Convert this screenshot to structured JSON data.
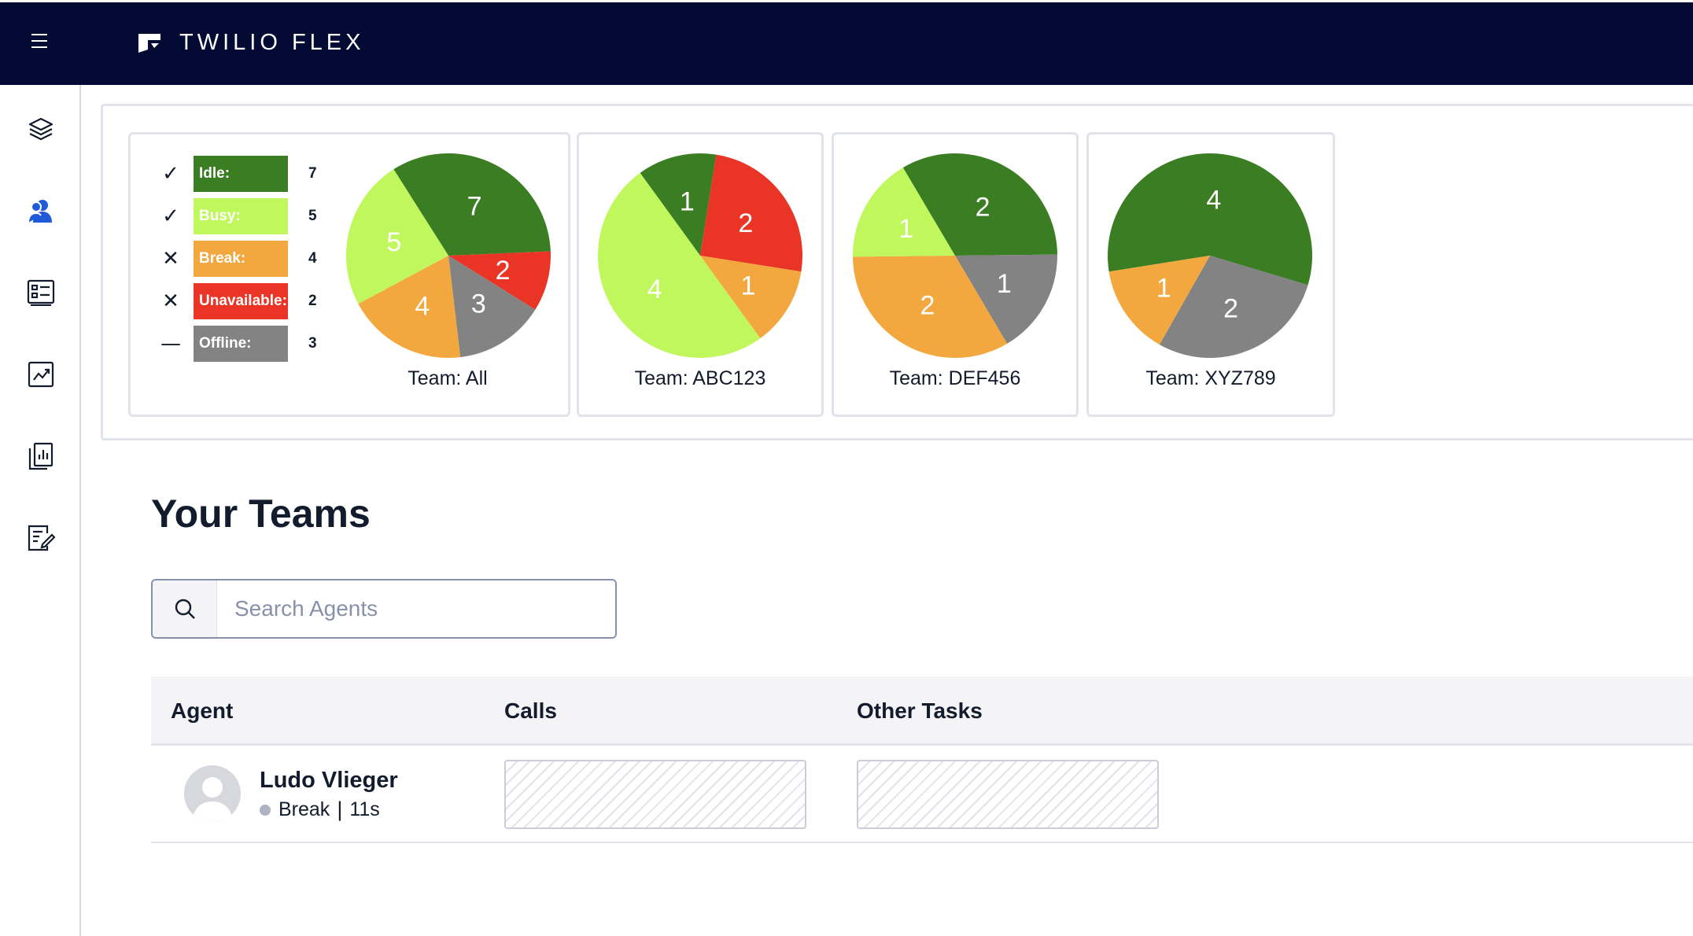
{
  "app": {
    "title": "TWILIO FLEX"
  },
  "legend": [
    {
      "mark": "✓",
      "label": "Idle:",
      "count": "7",
      "color": "#3a7d22"
    },
    {
      "mark": "✓",
      "label": "Busy:",
      "count": "5",
      "color": "#c0f75c"
    },
    {
      "mark": "✕",
      "label": "Break:",
      "count": "4",
      "color": "#f3a83f"
    },
    {
      "mark": "✕",
      "label": "Unavailable:",
      "count": "2",
      "color": "#e93426"
    },
    {
      "mark": "—",
      "label": "Offline:",
      "count": "3",
      "color": "#838383"
    }
  ],
  "teams": [
    {
      "label": "Team: All",
      "slices": [
        {
          "status": "Idle",
          "value": 7
        },
        {
          "status": "Unavailable",
          "value": 2
        },
        {
          "status": "Offline",
          "value": 3
        },
        {
          "status": "Break",
          "value": 4
        },
        {
          "status": "Busy",
          "value": 5
        }
      ]
    },
    {
      "label": "Team: ABC123",
      "slices": [
        {
          "status": "Idle",
          "value": 1
        },
        {
          "status": "Unavailable",
          "value": 2
        },
        {
          "status": "Break",
          "value": 1
        },
        {
          "status": "Busy",
          "value": 4
        }
      ]
    },
    {
      "label": "Team: DEF456",
      "slices": [
        {
          "status": "Idle",
          "value": 2
        },
        {
          "status": "Offline",
          "value": 1
        },
        {
          "status": "Break",
          "value": 2
        },
        {
          "status": "Busy",
          "value": 1
        }
      ]
    },
    {
      "label": "Team: XYZ789",
      "slices": [
        {
          "status": "Idle",
          "value": 4
        },
        {
          "status": "Offline",
          "value": 2
        },
        {
          "status": "Break",
          "value": 1
        }
      ]
    }
  ],
  "status_colors": {
    "Idle": "#3a7d22",
    "Busy": "#c0f75c",
    "Break": "#f3a83f",
    "Unavailable": "#e93426",
    "Offline": "#838383"
  },
  "chart_data": [
    {
      "type": "pie",
      "title": "Team: All",
      "categories": [
        "Idle",
        "Unavailable",
        "Offline",
        "Break",
        "Busy"
      ],
      "values": [
        7,
        2,
        3,
        4,
        5
      ]
    },
    {
      "type": "pie",
      "title": "Team: ABC123",
      "categories": [
        "Idle",
        "Unavailable",
        "Break",
        "Busy"
      ],
      "values": [
        1,
        2,
        1,
        4
      ]
    },
    {
      "type": "pie",
      "title": "Team: DEF456",
      "categories": [
        "Idle",
        "Offline",
        "Break",
        "Busy"
      ],
      "values": [
        2,
        1,
        2,
        1
      ]
    },
    {
      "type": "pie",
      "title": "Team: XYZ789",
      "categories": [
        "Idle",
        "Offline",
        "Break"
      ],
      "values": [
        4,
        2,
        1
      ]
    }
  ],
  "section": {
    "title": "Your Teams"
  },
  "search": {
    "placeholder": "Search Agents",
    "value": ""
  },
  "table": {
    "columns": [
      "Agent",
      "Calls",
      "Other Tasks"
    ],
    "rows": [
      {
        "name": "Ludo Vlieger",
        "status": "Break",
        "duration": "11s"
      }
    ]
  },
  "sidebar": {
    "items": [
      {
        "icon": "layers-icon"
      },
      {
        "icon": "agents-icon",
        "active": true
      },
      {
        "icon": "queue-stats-icon"
      },
      {
        "icon": "trend-chart-icon"
      },
      {
        "icon": "reports-icon"
      },
      {
        "icon": "edit-form-icon"
      }
    ]
  }
}
